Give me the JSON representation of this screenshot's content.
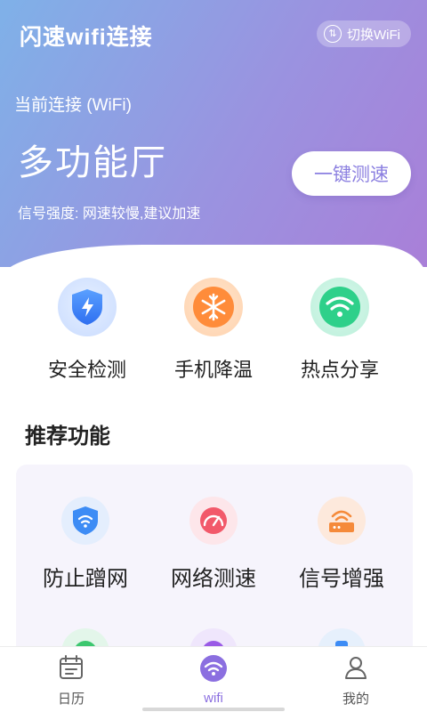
{
  "header": {
    "app_title": "闪速wifi连接",
    "switch_wifi_label": "切换WiFi",
    "current_connection_label": "当前连接 (WiFi)",
    "network_name": "多功能厅",
    "signal_status": "信号强度:  网速较慢,建议加速",
    "speed_test_button": "一键测速"
  },
  "tools": [
    {
      "label": "安全检测",
      "icon": "shield-bolt-icon"
    },
    {
      "label": "手机降温",
      "icon": "snowflake-icon"
    },
    {
      "label": "热点分享",
      "icon": "wifi-icon"
    }
  ],
  "recommend": {
    "title": "推荐功能",
    "items": [
      {
        "label": "防止蹭网",
        "icon": "wifi-shield-icon"
      },
      {
        "label": "网络测速",
        "icon": "speedometer-icon"
      },
      {
        "label": "信号增强",
        "icon": "router-icon"
      }
    ]
  },
  "bottom_nav": {
    "items": [
      {
        "label": "日历",
        "icon": "calendar-icon"
      },
      {
        "label": "wifi",
        "icon": "wifi-icon"
      },
      {
        "label": "我的",
        "icon": "user-icon"
      }
    ]
  },
  "colors": {
    "header_gradient_start": "#7fb1e8",
    "header_gradient_end": "#a97fd8",
    "accent_purple": "#8b6fe0"
  }
}
